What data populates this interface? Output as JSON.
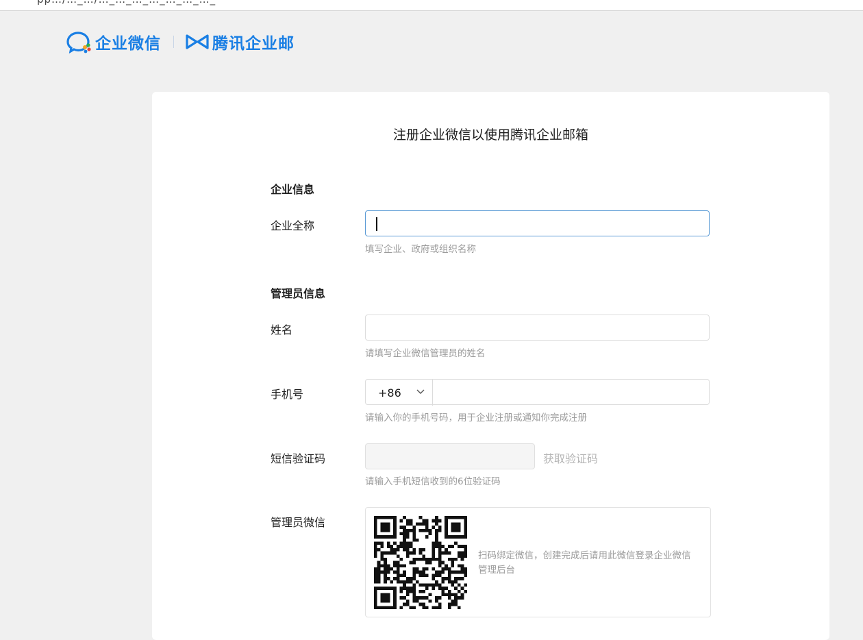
{
  "browser": {
    "url_fragment": "pp…/…_…/…_…_…_…_…_…_…_"
  },
  "brand": {
    "wework_name": "企业微信",
    "mail_name": "腾讯企业邮",
    "colors": {
      "brand_blue": "#1a7fe4"
    }
  },
  "page": {
    "title": "注册企业微信以使用腾讯企业邮箱"
  },
  "sections": {
    "company": {
      "heading": "企业信息"
    },
    "admin": {
      "heading": "管理员信息"
    }
  },
  "fields": {
    "company_name": {
      "label": "企业全称",
      "value": "",
      "hint": "填写企业、政府或组织名称"
    },
    "name": {
      "label": "姓名",
      "value": "",
      "hint": "请填写企业微信管理员的姓名"
    },
    "phone": {
      "label": "手机号",
      "country_code": "+86",
      "value": "",
      "hint": "请输入你的手机号码，用于企业注册或通知你完成注册"
    },
    "sms_code": {
      "label": "短信验证码",
      "value": "",
      "get_code_label": "获取验证码",
      "hint": "请输入手机短信收到的6位验证码"
    },
    "admin_wechat": {
      "label": "管理员微信",
      "qr_hint": "扫码绑定微信，创建完成后请用此微信登录企业微信管理后台"
    }
  }
}
